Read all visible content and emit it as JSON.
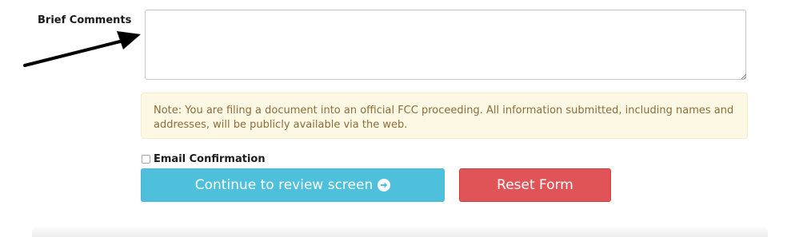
{
  "form": {
    "comments_label": "Brief Comments",
    "comments_value": "",
    "note_text": "Note: You are filing a document into an official FCC proceeding. All information submitted, including names and addresses, will be publicly available via the web.",
    "email_confirmation_label": "Email Confirmation",
    "email_confirmation_checked": false,
    "continue_button_label": "Continue to review screen",
    "continue_button_icon": "arrow-circle-right-icon",
    "reset_button_label": "Reset Form"
  },
  "colors": {
    "continue_button": "#4ec0dc",
    "reset_button": "#e05357",
    "note_background": "#fcf8e3",
    "note_text": "#8a6d3b"
  }
}
